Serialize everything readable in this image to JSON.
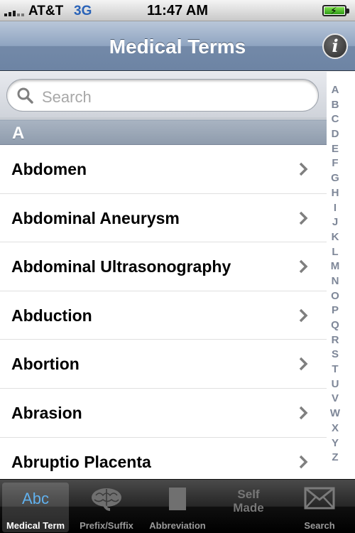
{
  "status_bar": {
    "carrier": "AT&T",
    "network": "3G",
    "time": "11:47 AM",
    "battery": "charging"
  },
  "nav": {
    "title": "Medical Terms",
    "info_glyph": "i"
  },
  "search": {
    "placeholder": "Search"
  },
  "section": {
    "letter": "A"
  },
  "terms": [
    "Abdomen",
    "Abdominal Aneurysm",
    "Abdominal Ultrasonography",
    "Abduction",
    "Abortion",
    "Abrasion",
    "Abruptio Placenta"
  ],
  "index": [
    "A",
    "B",
    "C",
    "D",
    "E",
    "F",
    "G",
    "H",
    "I",
    "J",
    "K",
    "L",
    "M",
    "N",
    "O",
    "P",
    "Q",
    "R",
    "S",
    "T",
    "U",
    "V",
    "W",
    "X",
    "Y",
    "Z"
  ],
  "tabs": [
    {
      "id": "medical-term",
      "label": "Medical Term",
      "icon_text": "Abc",
      "icon": "abc-icon",
      "selected": true
    },
    {
      "id": "prefix-suffix",
      "label": "Prefix/Suffix",
      "icon": "brain-icon",
      "selected": false
    },
    {
      "id": "abbreviation",
      "label": "Abbreviation",
      "icon": "square-icon",
      "selected": false
    },
    {
      "id": "self-made",
      "label": "",
      "icon_text_lines": [
        "Self",
        "Made"
      ],
      "icon": "self-made-icon",
      "selected": false
    },
    {
      "id": "search",
      "label": "Search",
      "icon": "envelope-icon",
      "selected": false
    }
  ],
  "colors": {
    "nav_bar": "#7a8fae",
    "index_text": "#7e8798",
    "network": "#2a63b8",
    "abc_icon": "#61b1ee"
  }
}
